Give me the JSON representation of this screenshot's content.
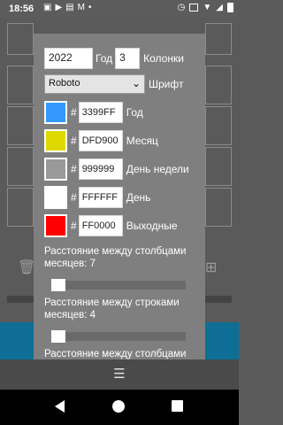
{
  "status_bar": {
    "time": "18:56",
    "notification_icons": [
      "image-icon",
      "youtube-icon",
      "document-icon",
      "gmail-icon",
      "dot-icon"
    ],
    "system_icons": [
      "alarm-icon",
      "vibrate-icon",
      "wifi-icon",
      "signal-icon",
      "battery-icon"
    ]
  },
  "dialog": {
    "year_value": "2022",
    "year_label": "Год",
    "columns_value": "3",
    "columns_label": "Колонки",
    "font_value": "Roboto",
    "font_label": "Шрифт",
    "colors": [
      {
        "swatch": "#3399FF",
        "hex": "3399FF",
        "label": "Год"
      },
      {
        "swatch": "#DFD900",
        "hex": "DFD900",
        "label": "Месяц"
      },
      {
        "swatch": "#999999",
        "hex": "999999",
        "label": "День недели"
      },
      {
        "swatch": "#FFFFFF",
        "hex": "FFFFFF",
        "label": "День"
      },
      {
        "swatch": "#FF0000",
        "hex": "FF0000",
        "label": "Выходные"
      }
    ],
    "sliders": [
      {
        "text": "Расстояние между столбцами месяцев: 7",
        "value": 7
      },
      {
        "text": "Расстояние между строками месяцев: 4",
        "value": 4
      },
      {
        "text": "Расстояние между столбцами"
      }
    ],
    "hash_symbol": "#"
  },
  "bottom_handle": {
    "icon": "menu-icon",
    "glyph": "☰"
  },
  "nav": {
    "back": "back-icon",
    "home": "home-icon",
    "recents": "recents-icon"
  }
}
